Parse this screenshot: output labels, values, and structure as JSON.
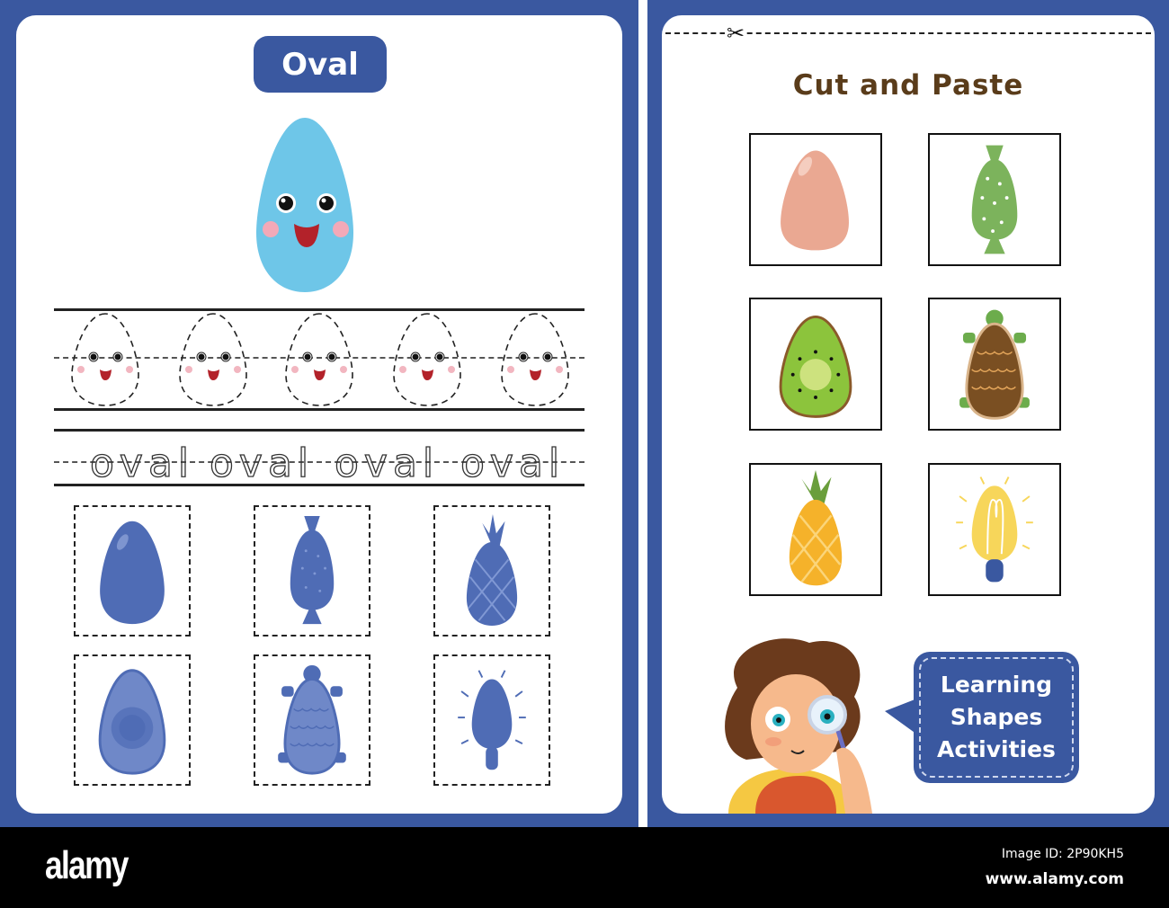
{
  "left_sheet": {
    "title": "Oval",
    "trace_word": "oval",
    "trace_word_count": 4,
    "trace_egg_count": 5,
    "silhouettes": [
      {
        "name": "egg"
      },
      {
        "name": "candy"
      },
      {
        "name": "pineapple"
      },
      {
        "name": "kiwi"
      },
      {
        "name": "turtle"
      },
      {
        "name": "light-bulb"
      }
    ]
  },
  "right_sheet": {
    "scissors_icon": "✂",
    "title": "Cut and Paste",
    "cards": [
      {
        "name": "egg"
      },
      {
        "name": "candy"
      },
      {
        "name": "kiwi"
      },
      {
        "name": "turtle"
      },
      {
        "name": "pineapple"
      },
      {
        "name": "light-bulb"
      }
    ],
    "bubble_lines": [
      "Learning",
      "Shapes",
      "Activities"
    ]
  },
  "footer": {
    "brand": "alamy",
    "image_id": "Image ID: 2P90KH5",
    "site": "www.alamy.com"
  },
  "colors": {
    "brand_blue": "#3a58a0",
    "title_brown": "#5a3c1a",
    "silhouette_blue": "#4f6cb5"
  }
}
